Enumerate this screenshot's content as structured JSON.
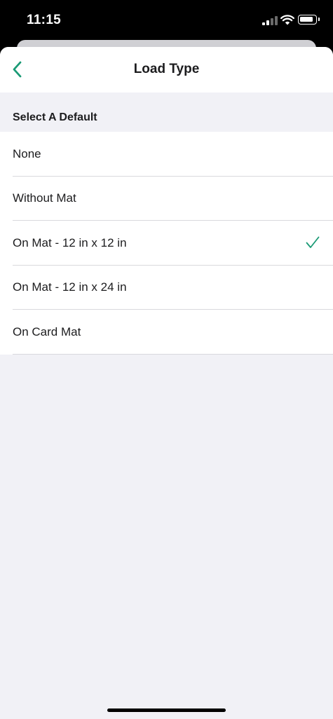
{
  "status_bar": {
    "time": "11:15"
  },
  "nav": {
    "title": "Load Type",
    "back_icon": "chevron-left-icon"
  },
  "section": {
    "header": "Select A Default"
  },
  "options": [
    {
      "label": "None",
      "selected": false
    },
    {
      "label": "Without Mat",
      "selected": false
    },
    {
      "label": "On Mat - 12 in x 12 in",
      "selected": true
    },
    {
      "label": "On Mat - 12 in x 24 in",
      "selected": false
    },
    {
      "label": "On Card Mat",
      "selected": false
    }
  ],
  "colors": {
    "accent": "#1a9a75",
    "background": "#f1f1f6"
  }
}
